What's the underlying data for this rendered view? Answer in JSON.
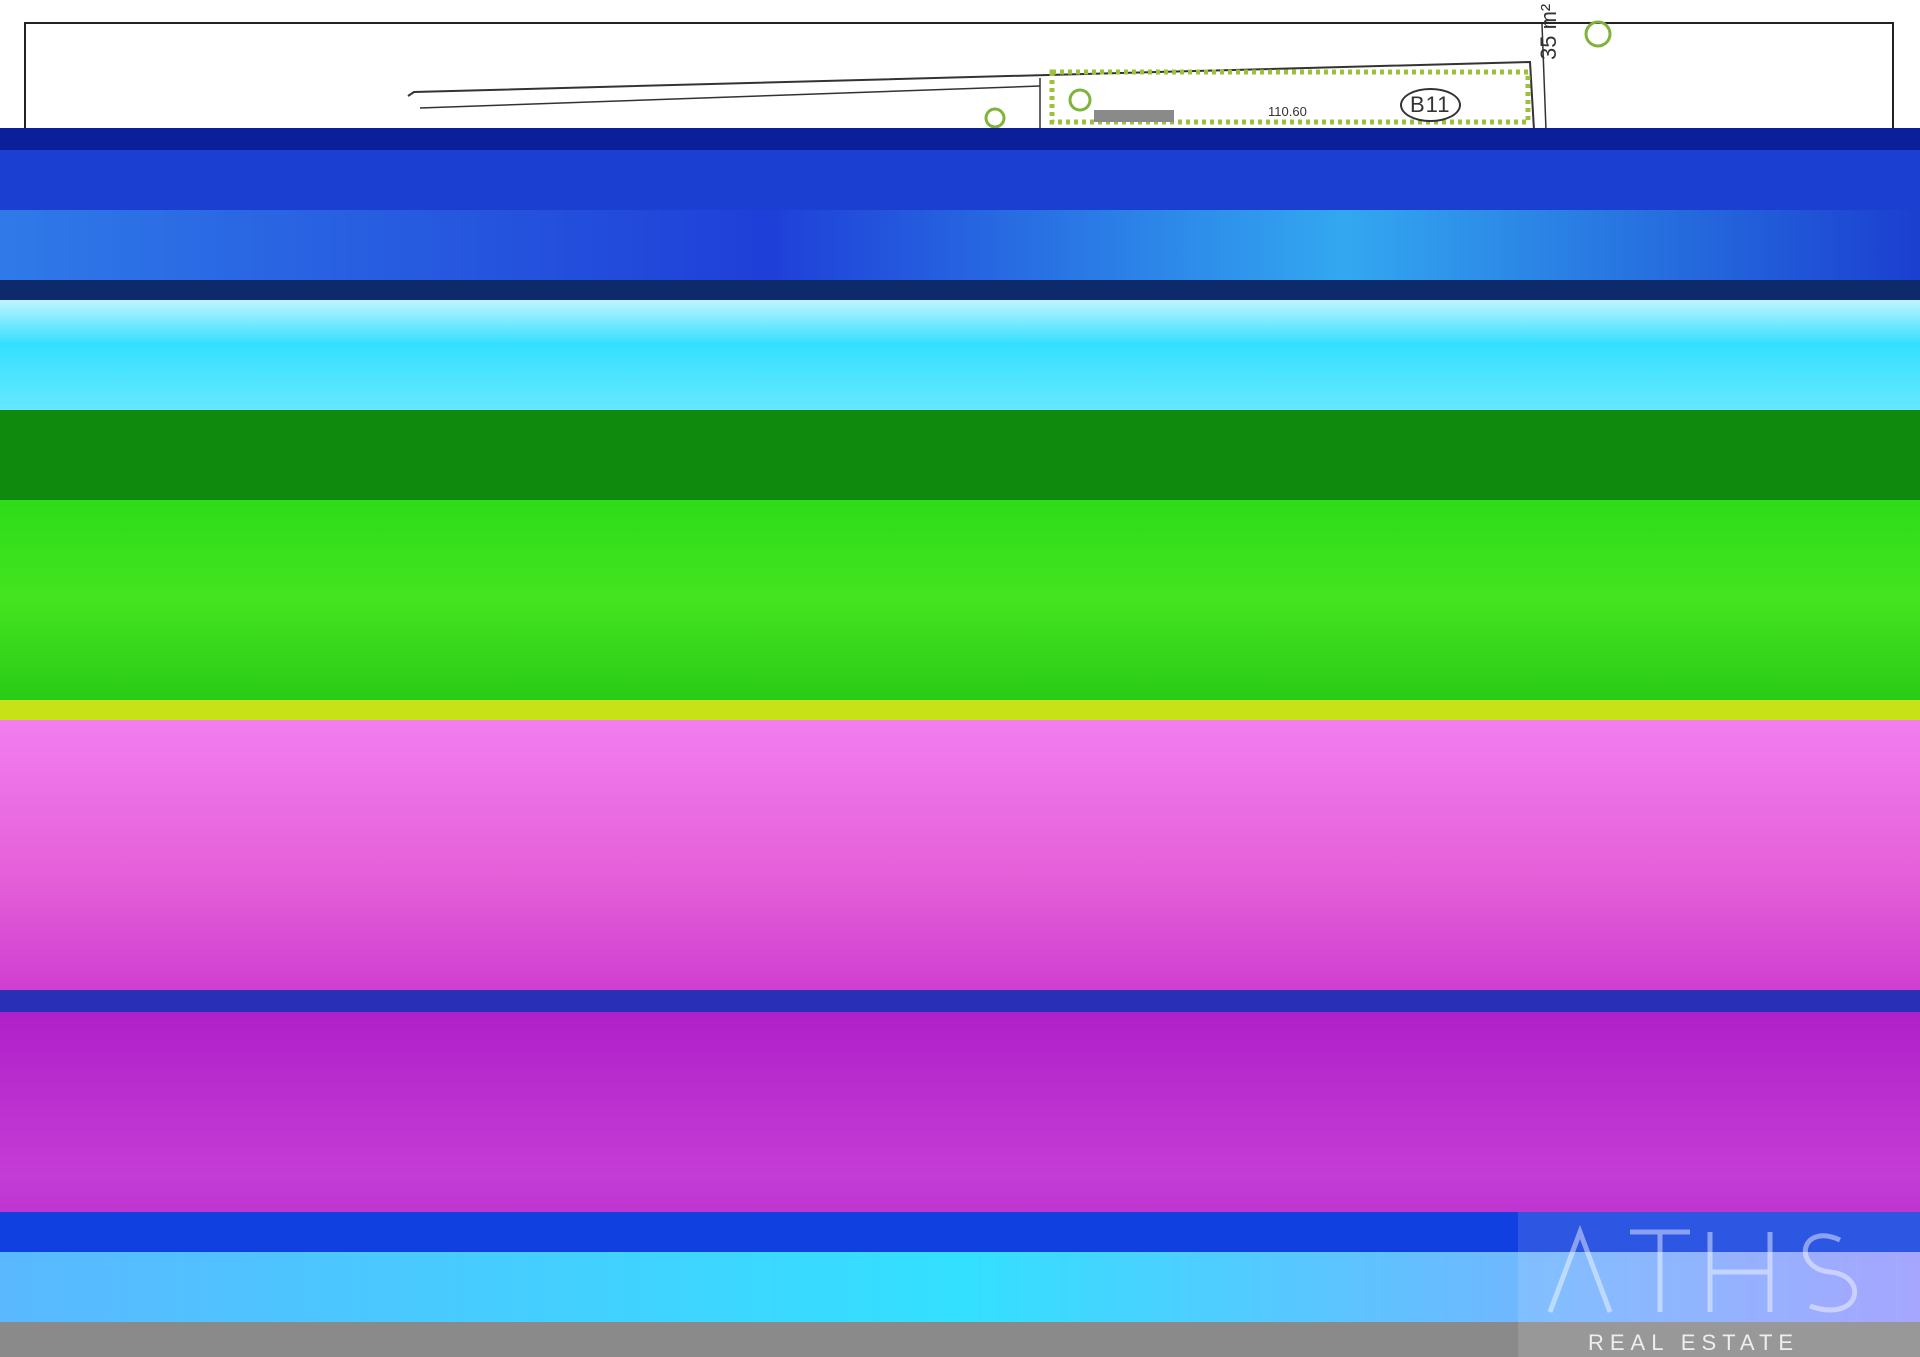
{
  "plan": {
    "plot_label": "B11",
    "area_label": "35 m²",
    "dimension_label": "110.60"
  },
  "watermark": {
    "tagline": "REAL ESTATE"
  },
  "colors": {
    "band_blue": "#1b3fd0",
    "band_cyan": "#33e0ff",
    "band_green": "#2edc18",
    "band_dark_green": "#0f8a0c",
    "band_pink": "#f27ef0",
    "band_purple": "#b020c8",
    "band_bottom_blue": "#1140e0",
    "band_gray": "#8a8a8a",
    "hedge_green": "#9bc23a"
  }
}
